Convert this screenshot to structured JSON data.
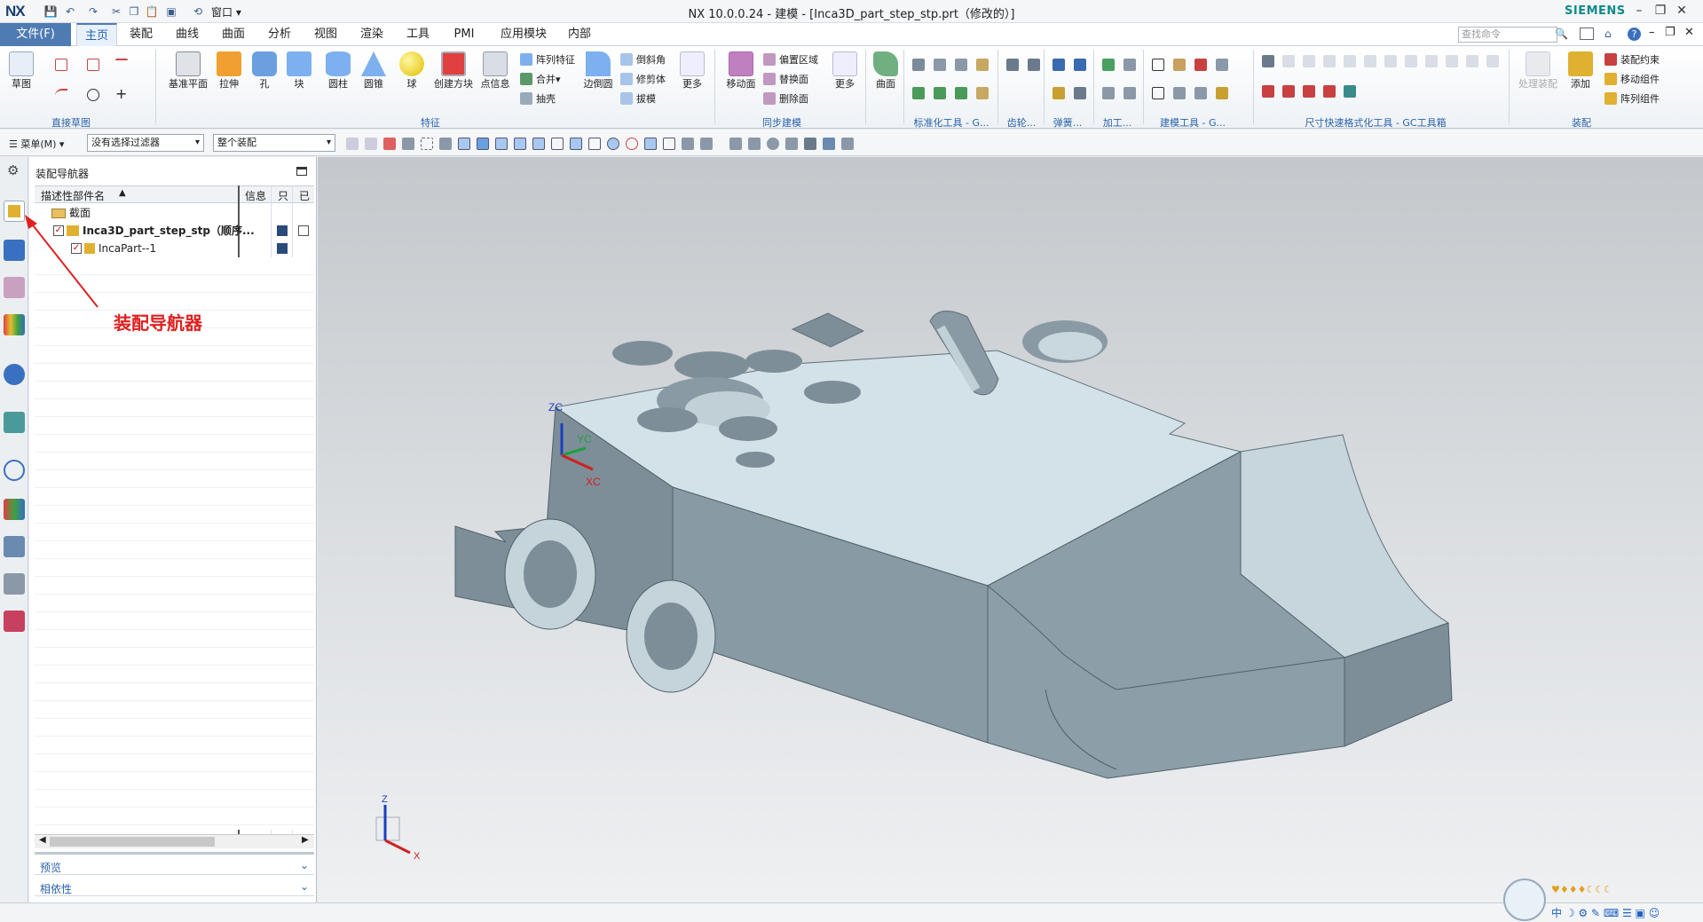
{
  "app": {
    "logo": "NX",
    "title": "NX 10.0.0.24 - 建模 - [Inca3D_part_step_stp.prt（修改的）]",
    "brand": "SIEMENS",
    "window_menu": "窗口"
  },
  "menubar": {
    "file": "文件(F)",
    "tabs": [
      "主页",
      "装配",
      "曲线",
      "曲面",
      "分析",
      "视图",
      "渲染",
      "工具",
      "PMI",
      "应用模块",
      "内部"
    ],
    "active_tab": "主页",
    "search_placeholder": "查找命令"
  },
  "ribbon": {
    "sketch_group": {
      "label": "直接草图",
      "sketch": "草图"
    },
    "feature_group": {
      "label": "特征",
      "buttons": [
        "基准平面",
        "拉伸",
        "孔",
        "块",
        "圆柱",
        "圆锥",
        "球",
        "创建方块",
        "点信息"
      ],
      "small": [
        "阵列特征",
        "合并",
        "抽壳"
      ],
      "edge_blend": "边倒圆",
      "small2": [
        "倒斜角",
        "修剪体",
        "拔模"
      ],
      "more": "更多"
    },
    "sync_group": {
      "label": "同步建模",
      "move_face": "移动面",
      "small": [
        "偏置区域",
        "替换面",
        "删除面"
      ],
      "more": "更多"
    },
    "surface": "曲面",
    "std_tools": "标准化工具 - G...",
    "gear": "齿轮...",
    "spring": "弹簧...",
    "machining": "加工...",
    "modeling_tools": "建模工具 - G...",
    "dim_tools": "尺寸快速格式化工具 - GC工具箱",
    "assembly_group": {
      "label": "装配",
      "handle": "处理装配",
      "add": "添加",
      "small": [
        "装配约束",
        "移动组件",
        "阵列组件"
      ]
    }
  },
  "toolbar2": {
    "menu": "菜单(M)",
    "filter": "没有选择过滤器",
    "scope": "整个装配"
  },
  "navigator": {
    "title": "装配导航器",
    "columns": [
      "描述性部件名",
      "信息",
      "只",
      "已"
    ],
    "rows": [
      {
        "label": "截面"
      },
      {
        "label": "Inca3D_part_step_stp（顺序..."
      },
      {
        "label": "IncaPart--1"
      }
    ],
    "preview": "预览",
    "dependency": "相依性"
  },
  "annotation": {
    "text": "装配导航器",
    "color": "#e02020"
  },
  "viewport": {
    "wcs": {
      "zc": "ZC",
      "yc": "YC",
      "xc": "XC"
    },
    "triad": {
      "z": "Z",
      "x": "X"
    }
  },
  "colors": {
    "accent": "#4f7bb3",
    "model_top": "#d2e2e8",
    "model_side": "#7e8e98"
  }
}
